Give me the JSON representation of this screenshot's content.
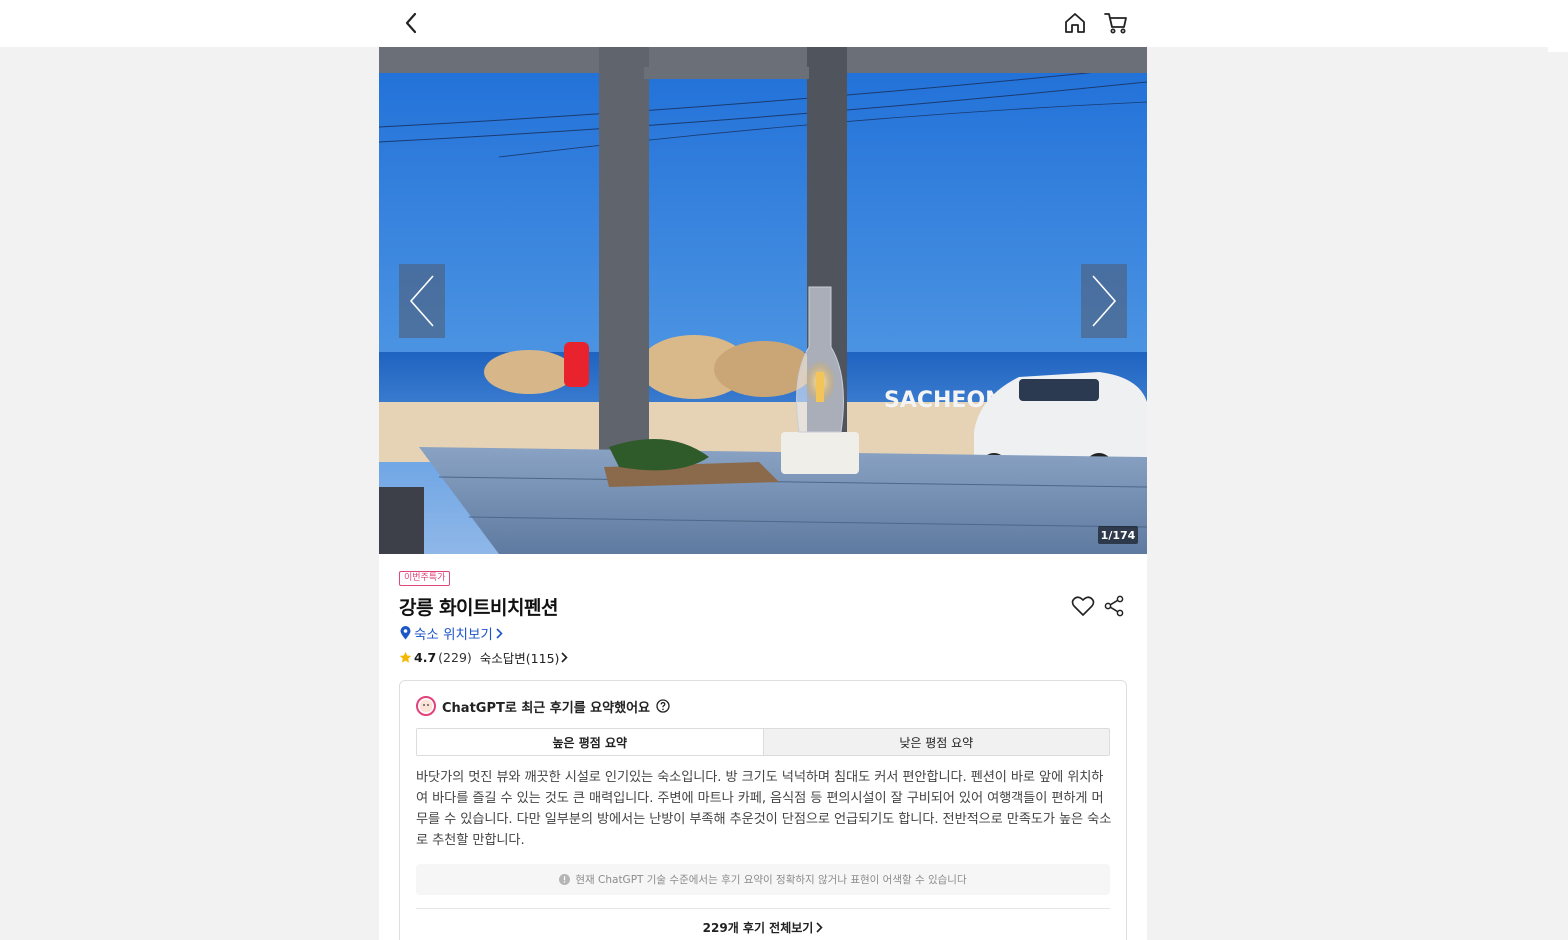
{
  "header": {
    "back_icon": "chevron-left-icon",
    "home_icon": "home-icon",
    "cart_icon": "cart-icon"
  },
  "gallery": {
    "counter_current": "1",
    "counter_total": "174",
    "counter_text": "1/174",
    "sign_text": "SACHEON",
    "prev_icon": "chevron-left-icon",
    "next_icon": "chevron-right-icon"
  },
  "property": {
    "badge": "이번주특가",
    "name": "강릉 화이트비치펜션",
    "location_link": "숙소 위치보기",
    "rating": "4.7",
    "review_count": "(229)",
    "host_reply_link": "숙소답변(115)"
  },
  "summary": {
    "heading": "ChatGPT로 최근 후기를 요약했어요",
    "tabs": [
      {
        "label": "높은 평점 요약",
        "active": true
      },
      {
        "label": "낮은 평점 요약",
        "active": false
      }
    ],
    "text": "바닷가의 멋진 뷰와 깨끗한 시설로 인기있는 숙소입니다. 방 크기도 넉넉하며 침대도 커서 편안합니다. 펜션이 바로 앞에 위치하여 바다를 즐길 수 있는 것도 큰 매력입니다. 주변에 마트나 카페, 음식점 등 편의시설이 잘 구비되어 있어 여행객들이 편하게 머무를 수 있습니다. 다만 일부분의 방에서는 난방이 부족해 추운것이 단점으로 언급되기도 합니다. 전반적으로 만족도가 높은 숙소로 추천할 만합니다.",
    "notice": "현재 ChatGPT 기술 수준에서는 후기 요약이 정확하지 않거나 표현이 어색할 수 있습니다",
    "all_reviews_link": "229개 후기 전체보기"
  },
  "colors": {
    "accent_blue": "#1d56c8",
    "badge_pink": "#e0457b",
    "star_yellow": "#f5b800",
    "page_bg": "#f2f2f2"
  }
}
